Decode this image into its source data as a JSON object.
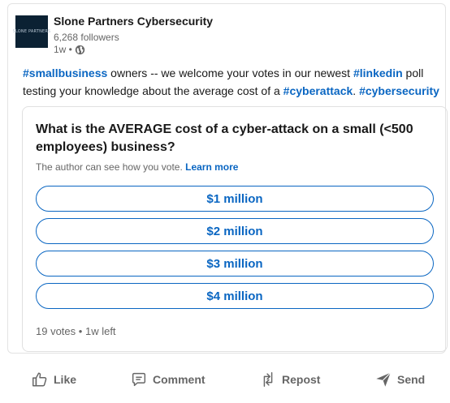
{
  "post": {
    "company_name": "Slone Partners Cybersecurity",
    "logo_text": "SLONE PARTNERS",
    "followers": "6,268 followers",
    "time": "1w •",
    "text_segments": [
      {
        "text": "#smallbusiness",
        "hashtag": true
      },
      {
        "text": " owners -- we welcome your votes in our newest ",
        "hashtag": false
      },
      {
        "text": "#linkedin",
        "hashtag": true
      },
      {
        "text": " poll testing your knowledge about the average cost of a ",
        "hashtag": false
      },
      {
        "text": "#cyberattack",
        "hashtag": true
      },
      {
        "text": ". ",
        "hashtag": false
      },
      {
        "text": "#cybersecurity",
        "hashtag": true
      }
    ]
  },
  "poll": {
    "question": "What is the AVERAGE cost of a cyber-attack on a small (<500 employees) business?",
    "notice": "The author can see how you vote.",
    "learn_more": "Learn more",
    "options": [
      "$1 million",
      "$2 million",
      "$3 million",
      "$4 million"
    ],
    "votes": "19 votes",
    "separator": "•",
    "time_left": "1w left"
  },
  "actions": {
    "like": "Like",
    "comment": "Comment",
    "repost": "Repost",
    "send": "Send"
  },
  "colors": {
    "accent": "#0a66c2",
    "muted": "#666666",
    "text": "#191919"
  },
  "icons": {
    "visibility": "globe-icon",
    "like": "thumbs-up-icon",
    "comment": "speech-bubble-icon",
    "repost": "repost-arrows-icon",
    "send": "paper-plane-icon"
  }
}
